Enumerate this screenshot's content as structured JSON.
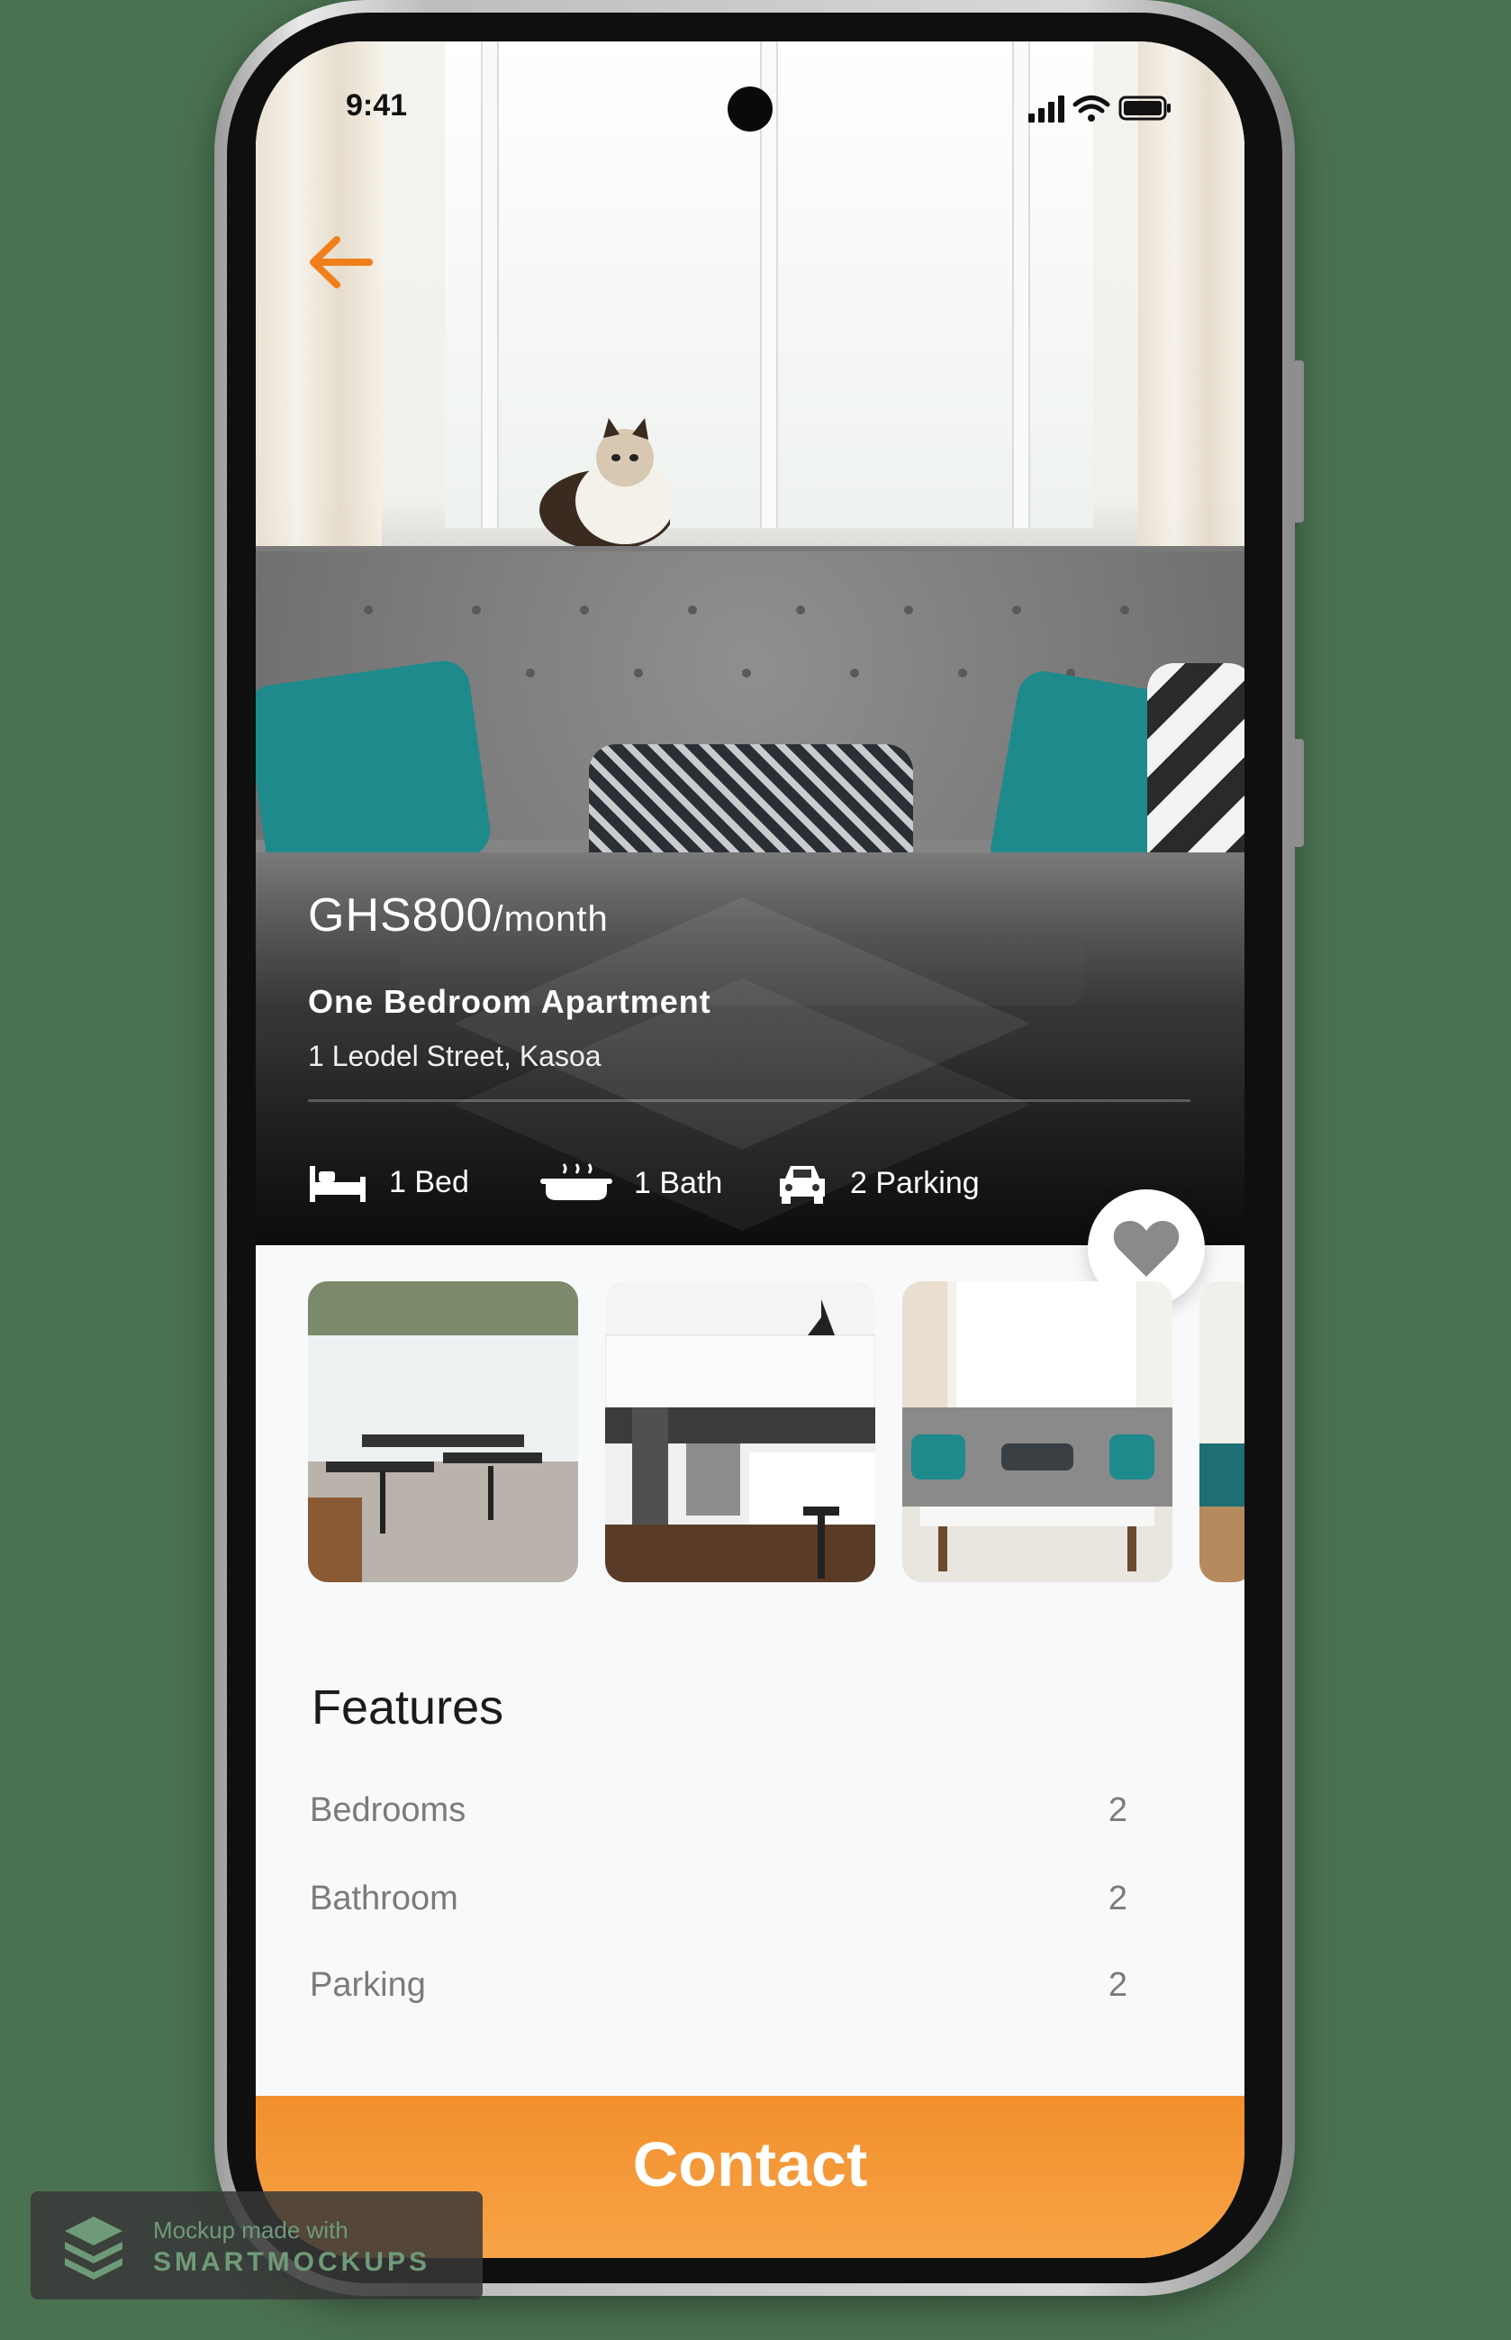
{
  "status_bar": {
    "time": "9:41"
  },
  "listing": {
    "price": "GHS800",
    "price_unit": "/month",
    "title": "One Bedroom Apartment",
    "address": "1 Leodel Street, Kasoa",
    "amenities": [
      {
        "icon": "bed-icon",
        "label": "1 Bed"
      },
      {
        "icon": "bathtub-icon",
        "label": "1 Bath"
      },
      {
        "icon": "car-icon",
        "label": "2 Parking"
      }
    ]
  },
  "gallery": {
    "thumbnails": [
      "dining-room",
      "kitchen",
      "living-room",
      "living-room-partial"
    ]
  },
  "features": {
    "title": "Features",
    "rows": [
      {
        "label": "Bedrooms",
        "value": "2"
      },
      {
        "label": "Bathroom",
        "value": "2"
      },
      {
        "label": "Parking",
        "value": "2"
      }
    ]
  },
  "actions": {
    "contact_label": "Contact"
  },
  "badge": {
    "line1": "Mockup made with",
    "line2": "SMARTMOCKUPS"
  },
  "colors": {
    "accent": "#F7931E",
    "heart": "#8a8a8a"
  }
}
